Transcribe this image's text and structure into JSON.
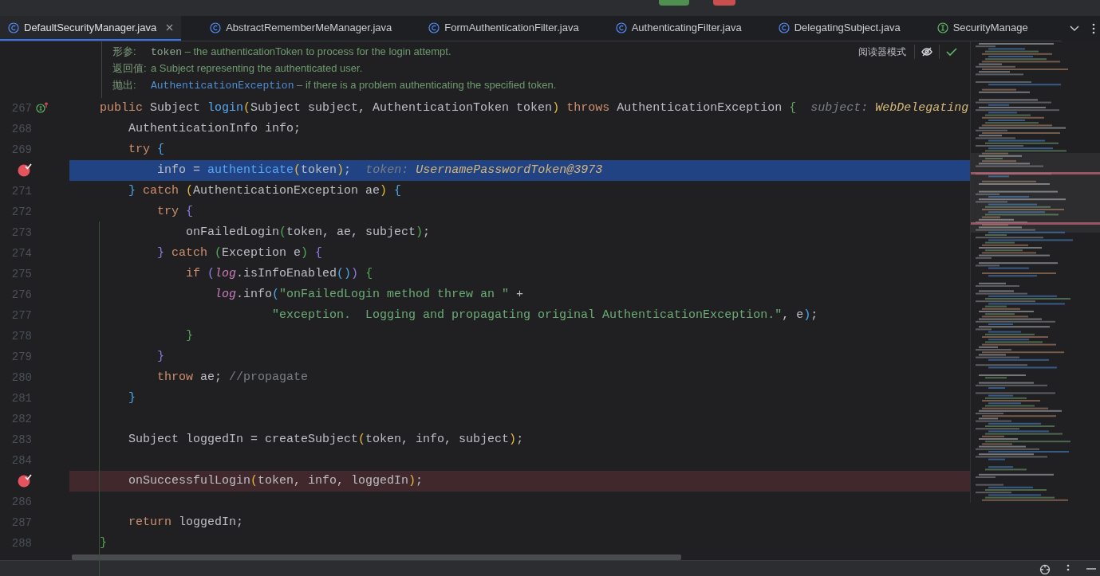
{
  "tabs": [
    {
      "label": "DefaultSecurityManager.java",
      "kind": "class",
      "selected": true
    },
    {
      "label": "AbstractRememberMeManager.java",
      "kind": "class",
      "selected": false
    },
    {
      "label": "FormAuthenticationFilter.java",
      "kind": "class",
      "selected": false
    },
    {
      "label": "AuthenticatingFilter.java",
      "kind": "class",
      "selected": false
    },
    {
      "label": "DelegatingSubject.java",
      "kind": "class",
      "selected": false
    },
    {
      "label": "SecurityManage",
      "kind": "interface",
      "selected": false
    }
  ],
  "doc": [
    {
      "label": "形参:",
      "parts": [
        {
          "t": "token",
          "kind": "code"
        },
        {
          "t": " – the authenticationToken to process for the login attempt.",
          "kind": "text"
        }
      ]
    },
    {
      "label": "返回值:",
      "parts": [
        {
          "t": "a Subject representing the authenticated user.",
          "kind": "text"
        }
      ]
    },
    {
      "label": "抛出:",
      "parts": [
        {
          "t": "AuthenticationException",
          "kind": "link"
        },
        {
          "t": " – if there is a problem authenticating the specified token.",
          "kind": "text"
        }
      ]
    }
  ],
  "reader_mode": "阅读器模式",
  "lines": [
    {
      "number": "267",
      "breakpoint": false,
      "current": false,
      "overrides": true,
      "segs": [
        {
          "t": "public",
          "kind": "kw"
        },
        {
          "t": " Subject ",
          "kind": "id"
        },
        {
          "t": "login",
          "kind": "fn"
        },
        {
          "t": "(",
          "kind": "by"
        },
        {
          "t": "Subject subject, AuthenticationToken token",
          "kind": "id"
        },
        {
          "t": ")",
          "kind": "by"
        },
        {
          "t": " throws",
          "kind": "kw"
        },
        {
          "t": " AuthenticationException ",
          "kind": "id"
        },
        {
          "t": "{",
          "kind": "bg"
        },
        {
          "t": "  subject: ",
          "kind": "hk"
        },
        {
          "t": "WebDelegating",
          "kind": "hv"
        }
      ]
    },
    {
      "number": "268",
      "breakpoint": false,
      "current": false,
      "overrides": false,
      "segs": [
        {
          "t": "    AuthenticationInfo info;",
          "kind": "id"
        }
      ]
    },
    {
      "number": "269",
      "breakpoint": false,
      "current": false,
      "overrides": false,
      "segs": [
        {
          "t": "    try",
          "kind": "kw"
        },
        {
          "t": " {",
          "kind": "bb"
        }
      ]
    },
    {
      "breakpoint": true,
      "current": true,
      "overrides": false,
      "segs": [
        {
          "t": "        info = ",
          "kind": "id"
        },
        {
          "t": "authenticate",
          "kind": "fn"
        },
        {
          "t": "(",
          "kind": "by"
        },
        {
          "t": "token",
          "kind": "id"
        },
        {
          "t": ")",
          "kind": "by"
        },
        {
          "t": ";",
          "kind": "id"
        },
        {
          "t": "  token: ",
          "kind": "hk"
        },
        {
          "t": "UsernamePasswordToken@3973",
          "kind": "hv"
        }
      ]
    },
    {
      "number": "271",
      "breakpoint": false,
      "current": false,
      "overrides": false,
      "segs": [
        {
          "t": "    }",
          "kind": "bb"
        },
        {
          "t": " catch",
          "kind": "kw"
        },
        {
          "t": " (",
          "kind": "by"
        },
        {
          "t": "AuthenticationException ae",
          "kind": "id"
        },
        {
          "t": ")",
          "kind": "by"
        },
        {
          "t": " {",
          "kind": "bb"
        }
      ]
    },
    {
      "number": "272",
      "breakpoint": false,
      "current": false,
      "overrides": false,
      "segs": [
        {
          "t": "        try",
          "kind": "kw"
        },
        {
          "t": " {",
          "kind": "bp"
        }
      ]
    },
    {
      "number": "273",
      "breakpoint": false,
      "current": false,
      "overrides": false,
      "segs": [
        {
          "t": "            onFailedLogin",
          "kind": "id"
        },
        {
          "t": "(",
          "kind": "bg"
        },
        {
          "t": "token, ae, subject",
          "kind": "id"
        },
        {
          "t": ")",
          "kind": "bg"
        },
        {
          "t": ";",
          "kind": "id"
        }
      ]
    },
    {
      "number": "274",
      "breakpoint": false,
      "current": false,
      "overrides": false,
      "segs": [
        {
          "t": "        }",
          "kind": "bp"
        },
        {
          "t": " catch",
          "kind": "kw"
        },
        {
          "t": " (",
          "kind": "bg"
        },
        {
          "t": "Exception e",
          "kind": "id"
        },
        {
          "t": ")",
          "kind": "bg"
        },
        {
          "t": " {",
          "kind": "bp"
        }
      ]
    },
    {
      "number": "275",
      "breakpoint": false,
      "current": false,
      "overrides": false,
      "segs": [
        {
          "t": "            if",
          "kind": "kw"
        },
        {
          "t": " (",
          "kind": "bp"
        },
        {
          "t": "log",
          "kind": "fd"
        },
        {
          "t": ".isInfoEnabled",
          "kind": "id"
        },
        {
          "t": "()",
          "kind": "bb"
        },
        {
          "t": ")",
          "kind": "bp"
        },
        {
          "t": " {",
          "kind": "bg"
        }
      ]
    },
    {
      "number": "276",
      "breakpoint": false,
      "current": false,
      "overrides": false,
      "segs": [
        {
          "t": "                log",
          "kind": "fd"
        },
        {
          "t": ".info",
          "kind": "id"
        },
        {
          "t": "(",
          "kind": "bb"
        },
        {
          "t": "\"onFailedLogin method threw an \"",
          "kind": "str"
        },
        {
          "t": " +",
          "kind": "id"
        }
      ]
    },
    {
      "number": "277",
      "breakpoint": false,
      "current": false,
      "overrides": false,
      "segs": [
        {
          "t": "                        \"exception.  Logging and propagating original AuthenticationException.\"",
          "kind": "str"
        },
        {
          "t": ", e",
          "kind": "id"
        },
        {
          "t": ")",
          "kind": "bb"
        },
        {
          "t": ";",
          "kind": "id"
        }
      ]
    },
    {
      "number": "278",
      "breakpoint": false,
      "current": false,
      "overrides": false,
      "segs": [
        {
          "t": "            }",
          "kind": "bg"
        }
      ]
    },
    {
      "number": "279",
      "breakpoint": false,
      "current": false,
      "overrides": false,
      "segs": [
        {
          "t": "        }",
          "kind": "bp"
        }
      ]
    },
    {
      "number": "280",
      "breakpoint": false,
      "current": false,
      "overrides": false,
      "segs": [
        {
          "t": "        throw",
          "kind": "kw"
        },
        {
          "t": " ae; ",
          "kind": "id"
        },
        {
          "t": "//propagate",
          "kind": "cm"
        }
      ]
    },
    {
      "number": "281",
      "breakpoint": false,
      "current": false,
      "overrides": false,
      "segs": [
        {
          "t": "    }",
          "kind": "bb"
        }
      ]
    },
    {
      "number": "282",
      "breakpoint": false,
      "current": false,
      "overrides": false
    },
    {
      "number": "283",
      "breakpoint": false,
      "current": false,
      "overrides": false,
      "segs": [
        {
          "t": "    Subject loggedIn = createSubject",
          "kind": "id"
        },
        {
          "t": "(",
          "kind": "by"
        },
        {
          "t": "token, info, subject",
          "kind": "id"
        },
        {
          "t": ")",
          "kind": "by"
        },
        {
          "t": ";",
          "kind": "id"
        }
      ]
    },
    {
      "number": "284",
      "breakpoint": false,
      "current": false,
      "overrides": false
    },
    {
      "breakpoint": true,
      "current": false,
      "overrides": false,
      "segs": [
        {
          "t": "    onSuccessfulLogin",
          "kind": "id"
        },
        {
          "t": "(",
          "kind": "by"
        },
        {
          "t": "token, info, loggedIn",
          "kind": "id"
        },
        {
          "t": ")",
          "kind": "by"
        },
        {
          "t": ";",
          "kind": "id"
        }
      ]
    },
    {
      "number": "286",
      "breakpoint": false,
      "current": false,
      "overrides": false
    },
    {
      "number": "287",
      "breakpoint": false,
      "current": false,
      "overrides": false,
      "segs": [
        {
          "t": "    return",
          "kind": "kw"
        },
        {
          "t": " loggedIn;",
          "kind": "id"
        }
      ]
    },
    {
      "number": "288",
      "breakpoint": false,
      "current": false,
      "overrides": false,
      "segs": [
        {
          "t": "}",
          "kind": "bg"
        }
      ]
    }
  ]
}
